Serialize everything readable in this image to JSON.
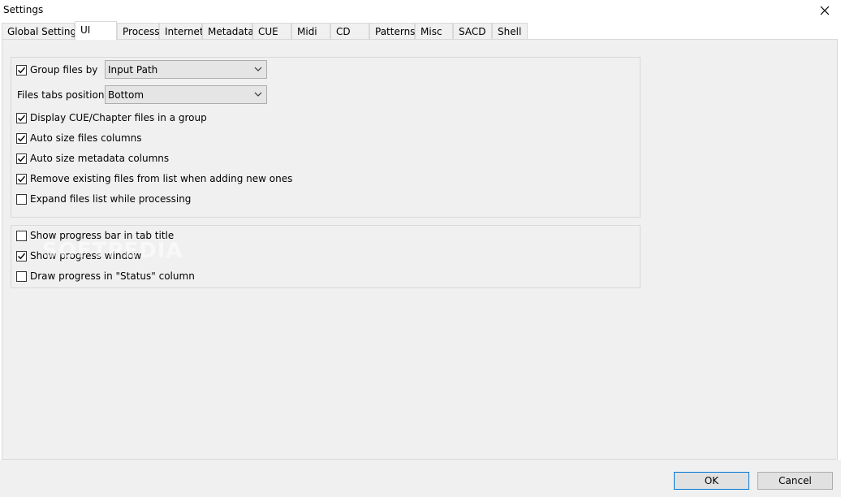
{
  "window": {
    "title": "Settings"
  },
  "tabs": [
    {
      "label": "Global Settings"
    },
    {
      "label": "UI"
    },
    {
      "label": "Process"
    },
    {
      "label": "Internet"
    },
    {
      "label": "Metadata"
    },
    {
      "label": "CUE"
    },
    {
      "label": "Midi"
    },
    {
      "label": "CD"
    },
    {
      "label": "Patterns"
    },
    {
      "label": "Misc"
    },
    {
      "label": "SACD"
    },
    {
      "label": "Shell"
    }
  ],
  "active_tab": "UI",
  "group1": {
    "group_files_by": {
      "label": "Group files by",
      "checked": true,
      "value": "Input Path"
    },
    "files_tabs_position": {
      "label": "Files tabs position",
      "value": "Bottom"
    },
    "display_cue": {
      "label": "Display CUE/Chapter files in a group",
      "checked": true
    },
    "auto_size_files": {
      "label": "Auto size files columns",
      "checked": true
    },
    "auto_size_metadata": {
      "label": "Auto size metadata columns",
      "checked": true
    },
    "remove_existing": {
      "label": "Remove existing files from list when adding new ones",
      "checked": true
    },
    "expand_list": {
      "label": "Expand files list while processing",
      "checked": false
    }
  },
  "group2": {
    "progress_bar_tab": {
      "label": "Show progress bar in tab title",
      "checked": false
    },
    "progress_window": {
      "label": "Show progress window",
      "checked": true
    },
    "progress_status": {
      "label": "Draw progress in \"Status\" column",
      "checked": false
    }
  },
  "watermark": "SOFTPEDIA",
  "buttons": {
    "ok": "OK",
    "cancel": "Cancel"
  }
}
